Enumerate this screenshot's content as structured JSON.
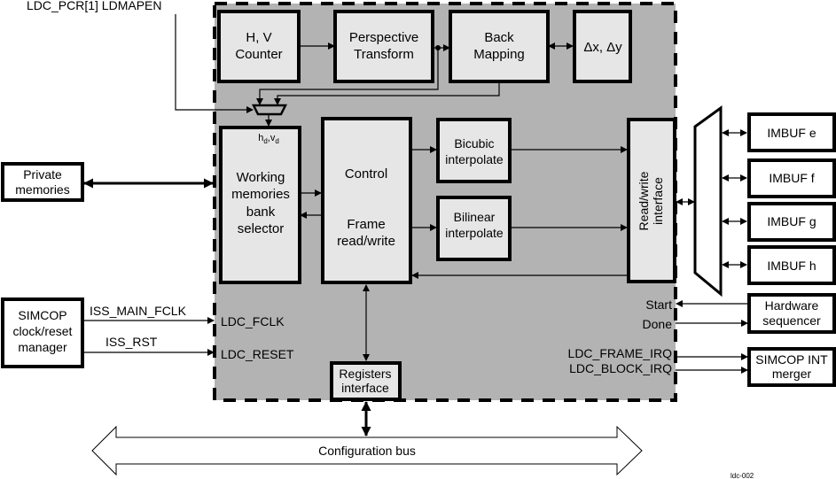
{
  "diagram": {
    "title_signal": "LDC_PCR[1] LDMAPEN",
    "figure_id": "ldc-002",
    "colors": {
      "module_fill": "#b3b3b3",
      "block_fill": "#e6e6e6",
      "external_fill": "#ffffff",
      "stroke": "#000000"
    },
    "ldc_module": {
      "blocks": {
        "hv_counter": [
          "H, V",
          "Counter"
        ],
        "perspective": [
          "Perspective",
          "Transform"
        ],
        "back_mapping": [
          "Back",
          "Mapping"
        ],
        "delta": [
          "Δx, Δy"
        ],
        "working_mem": [
          "Working",
          "memories",
          "bank",
          "selector"
        ],
        "working_mem_sub": "hd,vd",
        "control": [
          "Control"
        ],
        "frame_rw": [
          "Frame",
          "read/write"
        ],
        "bicubic": [
          "Bicubic",
          "interpolate"
        ],
        "bilinear": [
          "Bilinear",
          "interpolate"
        ],
        "rw_interface": [
          "Read/write",
          "interface"
        ],
        "registers": [
          "Registers",
          "interface"
        ]
      },
      "ports": {
        "ldc_fclk": "LDC_FCLK",
        "ldc_reset": "LDC_RESET",
        "start": "Start",
        "done": "Done",
        "frame_irq": "LDC_FRAME_IRQ",
        "block_irq": "LDC_BLOCK_IRQ"
      }
    },
    "external": {
      "private_memories": [
        "Private",
        "memories"
      ],
      "simcop_clock": [
        "SIMCOP",
        "clock/reset",
        "manager"
      ],
      "imbufs": [
        "IMBUF e",
        "IMBUF f",
        "IMBUF g",
        "IMBUF h"
      ],
      "hw_sequencer": [
        "Hardware",
        "sequencer"
      ],
      "int_merger": [
        "SIMCOP INT",
        "merger"
      ]
    },
    "signals": {
      "iss_main_fclk": "ISS_MAIN_FCLK",
      "iss_rst": "ISS_RST"
    },
    "bus": {
      "label": "Configuration bus"
    }
  }
}
